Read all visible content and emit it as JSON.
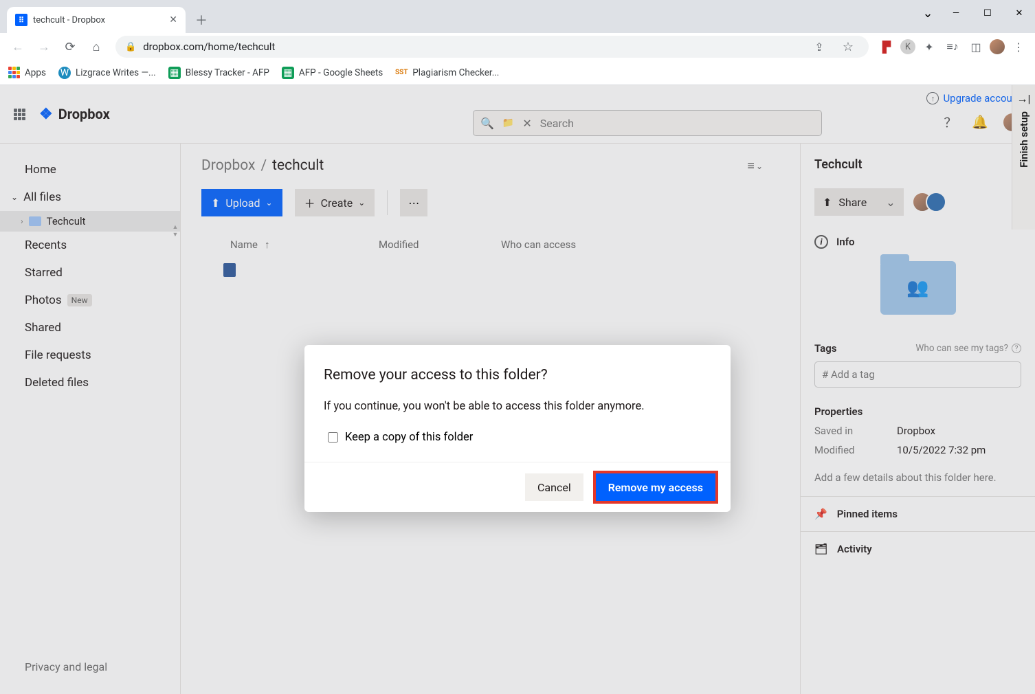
{
  "browser": {
    "tab_title": "techcult - Dropbox",
    "url_display": "dropbox.com/home/techcult",
    "bookmarks": [
      {
        "label": "Apps"
      },
      {
        "label": "Lizgrace Writes —..."
      },
      {
        "label": "Blessy Tracker - AFP"
      },
      {
        "label": "AFP - Google Sheets"
      },
      {
        "label": "Plagiarism Checker..."
      }
    ]
  },
  "header": {
    "brand": "Dropbox",
    "upgrade": "Upgrade account",
    "search_placeholder": "Search"
  },
  "sidebar": {
    "home": "Home",
    "all_files": "All files",
    "subfolder": "Techcult",
    "recents": "Recents",
    "starred": "Starred",
    "photos": "Photos",
    "photos_badge": "New",
    "shared": "Shared",
    "file_requests": "File requests",
    "deleted": "Deleted files",
    "privacy": "Privacy and legal"
  },
  "main": {
    "crumb_root": "Dropbox",
    "crumb_leaf": "techcult",
    "upload": "Upload",
    "create": "Create",
    "col_name": "Name",
    "col_modified": "Modified",
    "col_access": "Who can access"
  },
  "details": {
    "title": "Techcult",
    "share": "Share",
    "info": "Info",
    "tags": "Tags",
    "tags_q": "Who can see my tags?",
    "tag_placeholder": "# Add a tag",
    "properties": "Properties",
    "saved_in_k": "Saved in",
    "saved_in_v": "Dropbox",
    "modified_k": "Modified",
    "modified_v": "10/5/2022 7:32 pm",
    "add_details": "Add a few details about this folder here.",
    "pinned": "Pinned items",
    "activity": "Activity",
    "finish_setup": "Finish setup"
  },
  "modal": {
    "title": "Remove your access to this folder?",
    "body": "If you continue, you won't be able to access this folder anymore.",
    "checkbox": "Keep a copy of this folder",
    "cancel": "Cancel",
    "confirm": "Remove my access"
  }
}
